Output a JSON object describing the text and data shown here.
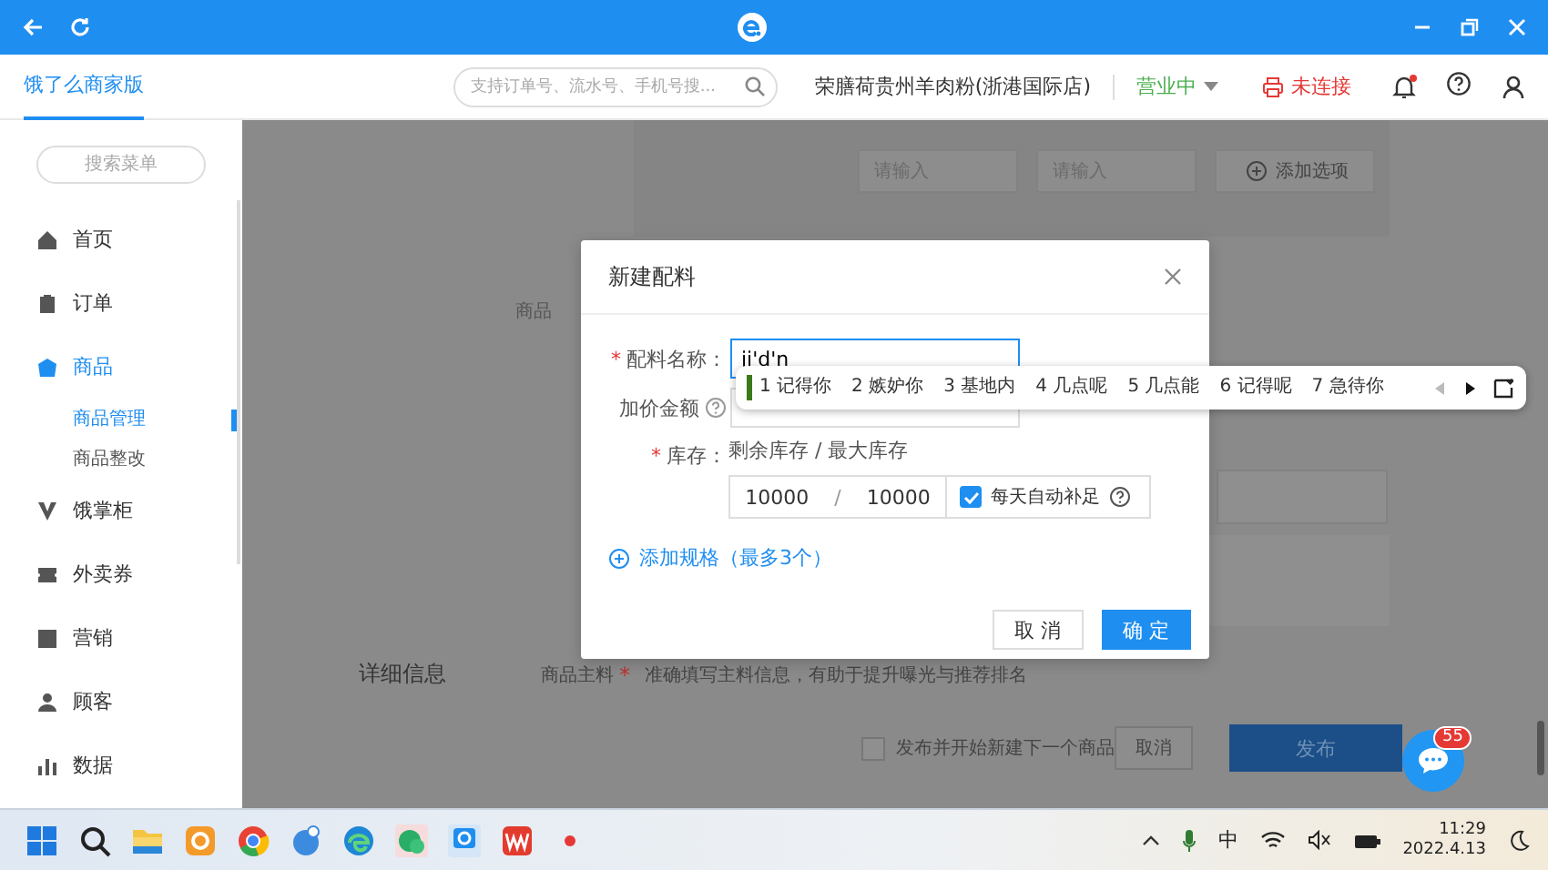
{
  "header": {
    "brand": "饿了么商家版",
    "search": {
      "placeholder": "支持订单号、流水号、手机号搜..."
    },
    "store": "荣膳荷贵州羊肉粉(浙港国际店)",
    "status": "营业中",
    "printer": "未连接",
    "notification": true
  },
  "sidebar": {
    "search": {
      "placeholder": "搜索菜单"
    },
    "items": [
      {
        "label": "首页",
        "selected": false
      },
      {
        "label": "订单",
        "selected": false
      },
      {
        "label": "商品",
        "selected": true,
        "children": [
          {
            "label": "商品管理",
            "selected": true
          },
          {
            "label": "商品整改",
            "selected": false
          }
        ]
      },
      {
        "label": "饿掌柜",
        "selected": false
      },
      {
        "label": "外卖券",
        "selected": false
      },
      {
        "label": "营销",
        "selected": false
      },
      {
        "label": "顾客",
        "selected": false
      },
      {
        "label": "数据",
        "selected": false
      }
    ]
  },
  "background": {
    "option_inputs": [
      {
        "placeholder": "请输入"
      },
      {
        "placeholder": "请输入"
      }
    ],
    "add_option": "添加选项",
    "cut_label": "商品",
    "section_title": "详细信息",
    "main_ingredient": {
      "label": "商品主料",
      "mark": "*",
      "hint": "准确填写主料信息，有助于提升曝光与推荐排名"
    },
    "footer": {
      "publish_next": {
        "label": "发布并开始新建下一个商品",
        "checked": false
      },
      "cancel": "取消",
      "publish": "发布"
    }
  },
  "chat": {
    "badge": "55"
  },
  "dialog": {
    "title": "新建配料",
    "name_field": {
      "mark": "*",
      "label": "配料名称：",
      "value": "ji'd'n"
    },
    "price_field": {
      "label": "加价金额"
    },
    "stock": {
      "mark": "*",
      "label": "库存：",
      "caption": "剩余库存 / 最大库存",
      "remaining": "10000",
      "separator": "/",
      "max": "10000",
      "auto_refill": {
        "label": "每天自动补足",
        "checked": true
      }
    },
    "add_spec": "添加规格（最多3个）",
    "buttons": [
      {
        "label": "取 消",
        "kind": "default"
      },
      {
        "label": "确 定",
        "kind": "primary"
      }
    ]
  },
  "ime": {
    "candidates": [
      {
        "label": "1 记得你",
        "selected": true
      },
      {
        "label": "2 嫉妒你",
        "selected": false
      },
      {
        "label": "3 基地内",
        "selected": false
      },
      {
        "label": "4 几点呢",
        "selected": false
      },
      {
        "label": "5 几点能",
        "selected": false
      },
      {
        "label": "6 记得呢",
        "selected": false
      },
      {
        "label": "7 急待你",
        "selected": false
      }
    ]
  },
  "taskbar": {
    "ime": "中",
    "time": "11:29",
    "date": "2022.4.13"
  }
}
